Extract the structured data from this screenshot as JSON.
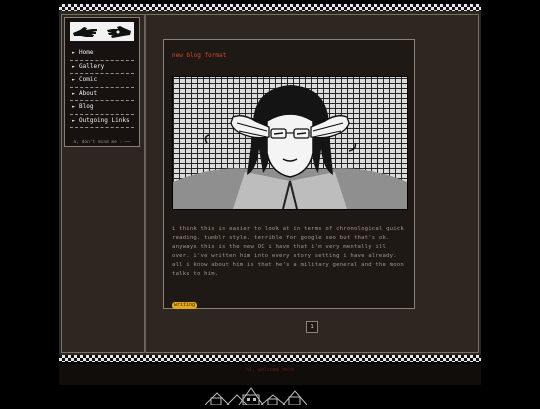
{
  "colors": {
    "page_bg": "#2e2620",
    "post_bg": "#1f1915",
    "title_accent": "#d4472a",
    "body_text": "#a2968a",
    "tag_chip": "#e3a81c"
  },
  "sidebar": {
    "logo_icon": "hands-logo",
    "items": [
      {
        "label": "Home"
      },
      {
        "label": "Gallery"
      },
      {
        "label": "Comic"
      },
      {
        "label": "About"
      },
      {
        "label": "Blog"
      },
      {
        "label": "Outgoing Links"
      }
    ],
    "footer": "a, don't mind me :-~~"
  },
  "post": {
    "title": "new blog format",
    "image_icon": "character-illustration",
    "body": "i think this is easier to look at in terms of chronological quick reading. tumblr style. terrible for google seo but that's ok. anyways this is the new OC i have that i'm very mentally ill over. i've written him into every story setting i have already. all i know about him is that he's a military general and the moon talks to him.",
    "tag": "writing"
  },
  "pagination": {
    "current": "1"
  },
  "footer": {
    "credit": "hi, welcome here",
    "skyline_icon": "pixel-town-icon"
  }
}
